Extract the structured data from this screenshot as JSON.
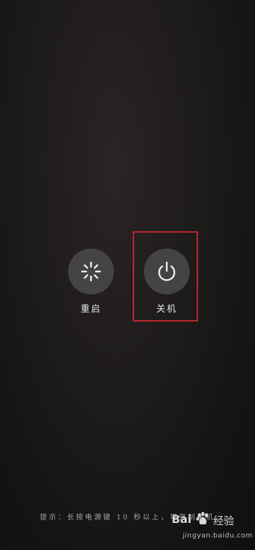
{
  "power_menu": {
    "restart": {
      "label": "重启",
      "icon": "restart-spinner-icon"
    },
    "power_off": {
      "label": "关机",
      "icon": "power-icon"
    }
  },
  "hint": "提示：长按电源键 10 秒以上，可强制关机",
  "watermark": {
    "brand": "Bai",
    "text": "经验",
    "domain": "jingyan.baidu.com"
  },
  "colors": {
    "highlight": "#c0262d",
    "button_bg": "#454343"
  }
}
